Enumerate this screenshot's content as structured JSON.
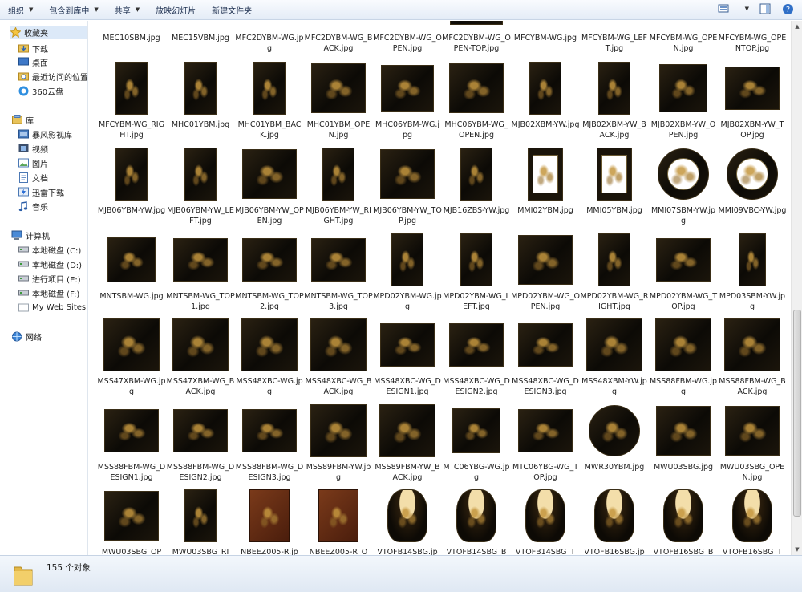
{
  "toolbar": {
    "organize": "组织",
    "include_in_library": "包含到库中",
    "share": "共享",
    "slideshow": "放映幻灯片",
    "new_folder": "新建文件夹",
    "icons": [
      "view-options-icon",
      "preview-pane-icon",
      "help-icon"
    ]
  },
  "sidebar": {
    "favorites": {
      "title": "收藏夹",
      "items": [
        "下载",
        "桌面",
        "最近访问的位置",
        "360云盘"
      ]
    },
    "libraries": {
      "title": "库",
      "items": [
        "暴风影视库",
        "视频",
        "图片",
        "文档",
        "迅雷下载",
        "音乐"
      ]
    },
    "computer": {
      "title": "计算机",
      "items": [
        "本地磁盘 (C:)",
        "本地磁盘 (D:)",
        "进行项目 (E:)",
        "本地磁盘 (F:)",
        "My Web Sites c"
      ]
    },
    "network": {
      "title": "网络"
    }
  },
  "files": {
    "rows": [
      [
        "MEC10SBM.jpg",
        "MEC15VBM.jpg",
        "MFC2DYBM-WG.jpg",
        "MFC2DYBM-WG_BACK.jpg",
        "MFC2DYBM-WG_OPEN.jpg",
        "MFC2DYBM-WG_OPEN-TOP.jpg",
        "MFCYBM-WG.jpg",
        "MFCYBM-WG_LEFT.jpg",
        "MFCYBM-WG_OPEN.jpg",
        "MFCYBM-WG_OPENTOP.jpg"
      ],
      [
        "MFCYBM-WG_RIGHT.jpg",
        "MHC01YBM.jpg",
        "MHC01YBM_BACK.jpg",
        "MHC01YBM_OPEN.jpg",
        "MHC06YBM-WG.jpg",
        "MHC06YBM-WG_OPEN.jpg",
        "MJB02XBM-YW.jpg",
        "MJB02XBM-YW_BACK.jpg",
        "MJB02XBM-YW_OPEN.jpg",
        "MJB02XBM-YW_TOP.jpg"
      ],
      [
        "MJB06YBM-YW.jpg",
        "MJB06YBM-YW_LEFT.jpg",
        "MJB06YBM-YW_OPEN.jpg",
        "MJB06YBM-YW_RIGHT.jpg",
        "MJB06YBM-YW_TOP.jpg",
        "MJB16ZBS-YW.jpg",
        "MMI02YBM.jpg",
        "MMI05YBM.jpg",
        "MMI07SBM-YW.jpg",
        "MMI09VBC-YW.jpg"
      ],
      [
        "MNTSBM-WG.jpg",
        "MNTSBM-WG_TOP1.jpg",
        "MNTSBM-WG_TOP2.jpg",
        "MNTSBM-WG_TOP3.jpg",
        "MPD02YBM-WG.jpg",
        "MPD02YBM-WG_LEFT.jpg",
        "MPD02YBM-WG_OPEN.jpg",
        "MPD02YBM-WG_RIGHT.jpg",
        "MPD02YBM-WG_TOP.jpg",
        "MPD03SBM-YW.jpg"
      ],
      [
        "MSS47XBM-WG.jpg",
        "MSS47XBM-WG_BACK.jpg",
        "MSS48XBC-WG.jpg",
        "MSS48XBC-WG_BACK.jpg",
        "MSS48XBC-WG_DESIGN1.jpg",
        "MSS48XBC-WG_DESIGN2.jpg",
        "MSS48XBC-WG_DESIGN3.jpg",
        "MSS48XBM-YW.jpg",
        "MSS88FBM-WG.jpg",
        "MSS88FBM-WG_BACK.jpg"
      ],
      [
        "MSS88FBM-WG_DESIGN1.jpg",
        "MSS88FBM-WG_DESIGN2.jpg",
        "MSS88FBM-WG_DESIGN3.jpg",
        "MSS89FBM-YW.jpg",
        "MSS89FBM-YW_BACK.jpg",
        "MTC06YBG-WG.jpg",
        "MTC06YBG-WG_TOP.jpg",
        "MWR30YBM.jpg",
        "MWU03SBG.jpg",
        "MWU03SBG_OPEN.jpg"
      ],
      [
        "MWU03SBG_OP",
        "MWU03SBG_RI",
        "NBEEZ005-R.jp",
        "NBEEZ005-R_O",
        "VTOFB14SBG.jp",
        "VTOFB14SBG_B",
        "VTOFB14SBG_T",
        "VTOFB16SBG.jp",
        "VTOFB16SBG_B",
        "VTOFB16SBG_T"
      ]
    ],
    "thumb_kinds": [
      [
        "none",
        "none",
        "none",
        "none",
        "none",
        "cabinet",
        "none",
        "none",
        "none",
        "none"
      ],
      [
        "tall",
        "tall",
        "tall",
        "open",
        "cabinet",
        "open",
        "tall",
        "tall",
        "box",
        "panel"
      ],
      [
        "tall",
        "tall",
        "open",
        "tall",
        "open",
        "tall",
        "mirror",
        "mirror",
        "roundmirror",
        "roundmirror"
      ],
      [
        "table",
        "panel",
        "panel",
        "panel",
        "tall",
        "tall",
        "open",
        "tall",
        "panel",
        "stand"
      ],
      [
        "screen",
        "screen",
        "screen",
        "screen",
        "panel",
        "panel",
        "panel",
        "screen",
        "screen",
        "screen"
      ],
      [
        "panel",
        "panel",
        "panel",
        "screen",
        "screen",
        "table",
        "panel",
        "round",
        "open",
        "open"
      ],
      [
        "open",
        "tall",
        "red",
        "red",
        "vase",
        "vase",
        "vase",
        "vase",
        "vase",
        "vase"
      ]
    ]
  },
  "status": {
    "count": "155 个对象"
  }
}
